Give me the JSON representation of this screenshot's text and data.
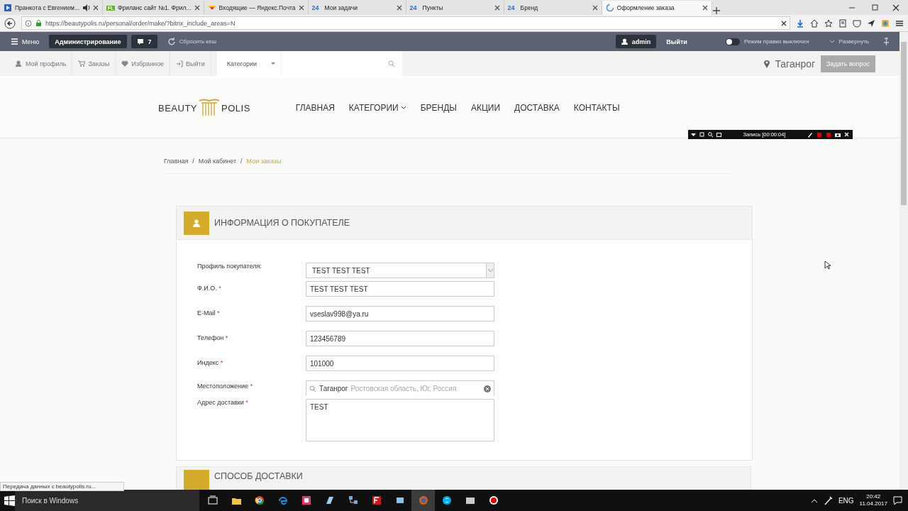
{
  "browser": {
    "tabs": [
      {
        "title": "Пранкота с Евгением...",
        "audio": true,
        "selected": false
      },
      {
        "title": "Фриланс сайт №1. Фрил...",
        "favicon": "FL",
        "audio": false,
        "selected": false
      },
      {
        "title": "Входящие — Яндекс.Почта",
        "audio": false,
        "selected": false
      },
      {
        "title": "Мои задачи",
        "favicon": "24",
        "audio": false,
        "selected": false
      },
      {
        "title": "Пункты",
        "favicon": "24",
        "audio": false,
        "selected": false
      },
      {
        "title": "Бренд",
        "favicon": "24",
        "audio": false,
        "selected": false
      },
      {
        "title": "Оформление заказа",
        "audio": false,
        "selected": true
      }
    ],
    "url": "https://beautypolis.ru/personal/order/make/?bitrix_include_areas=N"
  },
  "admin_bar": {
    "menu": "Меню",
    "admin": "Администрирование",
    "comments": "7",
    "cache": "Сбросить кеш",
    "user": "admin",
    "logout": "Выйти",
    "edit_mode": {
      "label": "Режим правки",
      "state": "выключен",
      "on": false
    },
    "expand": "Развернуть"
  },
  "topbar": {
    "links": [
      "Мой профиль",
      "Заказы",
      "Избранное",
      "Выйти"
    ],
    "categories": "Категории",
    "city": "Таганрог",
    "ask": "Задать вопрос"
  },
  "header": {
    "logo": {
      "left": "BEAUTY",
      "right": "POLIS"
    },
    "nav": [
      {
        "label": "ГЛАВНАЯ",
        "dropdown": false
      },
      {
        "label": "КАТЕГОРИИ",
        "dropdown": true
      },
      {
        "label": "БРЕНДЫ",
        "dropdown": false
      },
      {
        "label": "АКЦИИ",
        "dropdown": false
      },
      {
        "label": "ДОСТАВКА",
        "dropdown": false
      },
      {
        "label": "КОНТАКТЫ",
        "dropdown": false
      }
    ]
  },
  "recorder": {
    "label": "Запись [00:00:04]"
  },
  "breadcrumbs": {
    "separator": "/",
    "items": [
      {
        "label": "Главная",
        "current": false
      },
      {
        "label": "Мой кабинет",
        "current": false
      },
      {
        "label": "Мои заказы",
        "current": true
      }
    ]
  },
  "buyer_section": {
    "title": "ИНФОРМАЦИЯ О ПОКУПАТЕЛЕ",
    "fields": [
      {
        "kind": "select",
        "label": "Профиль покупателя:",
        "value": "TEST TEST TEST"
      },
      {
        "kind": "text",
        "label": "Ф.И.О.",
        "mark": "*",
        "value": "TEST TEST TEST"
      },
      {
        "kind": "text",
        "label": "E-Mail",
        "mark": "*",
        "value": "vseslav998@ya.ru"
      },
      {
        "kind": "text",
        "label": "Телефон",
        "mark": "*",
        "value": "123456789"
      },
      {
        "kind": "text",
        "label": "Индекс",
        "mark": "*",
        "value": "101000"
      },
      {
        "kind": "location",
        "label": "Местоположение",
        "mark": "*",
        "value": "Таганрог",
        "detail": "Ростовская область, Юг, Россия"
      },
      {
        "kind": "textarea",
        "label": "Адрес доставки",
        "mark": "*",
        "value": "TEST"
      }
    ]
  },
  "delivery_section": {
    "title": "СПОСОБ ДОСТАВКИ"
  },
  "status_text": "Передача данных с beautypolis.ru...",
  "taskbar": {
    "search": "Поиск в Windows",
    "lang": "ENG",
    "time": "20:42",
    "date": "11.04.2017"
  }
}
